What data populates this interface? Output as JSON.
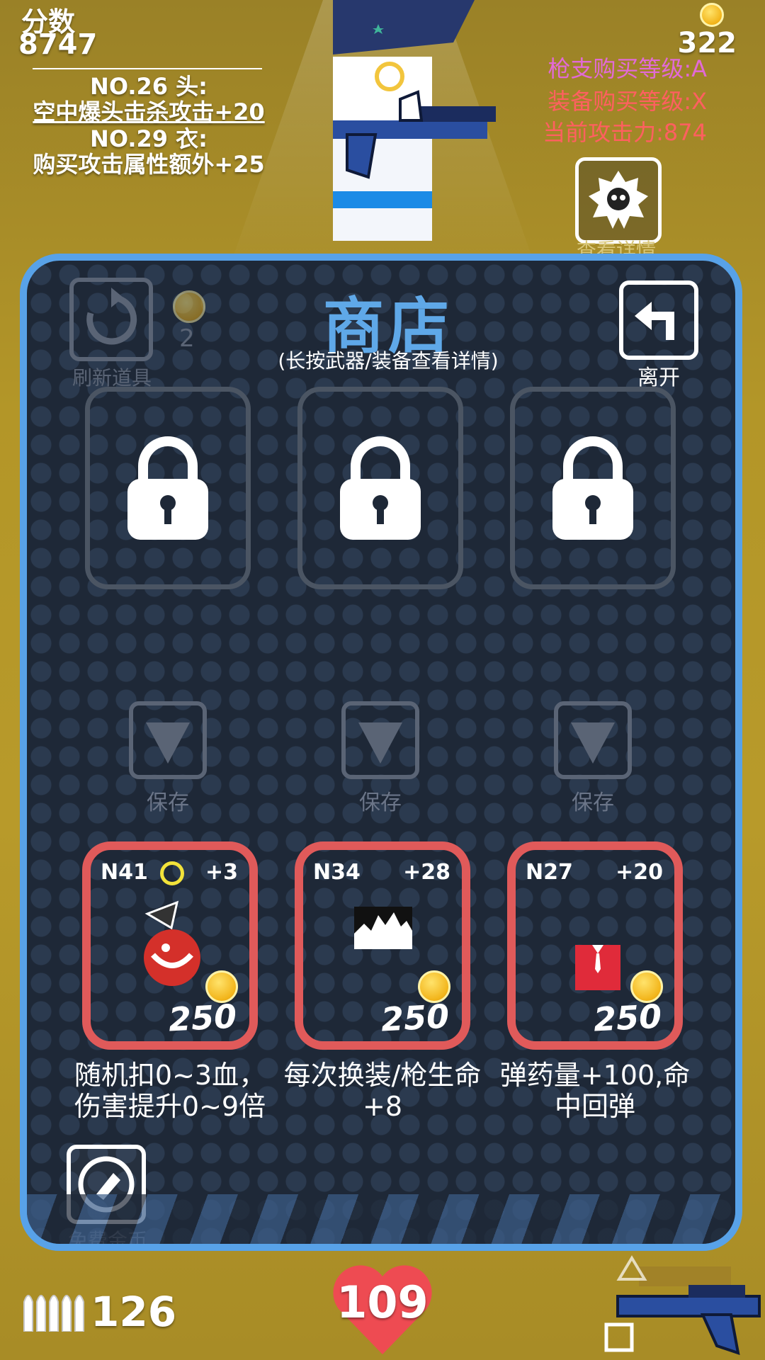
{
  "hud": {
    "score_label": "分数",
    "score_value": "8747",
    "buffs": [
      {
        "title": "NO.26 头:",
        "desc": "空中爆头击杀攻击+20"
      },
      {
        "title": "NO.29 衣:",
        "desc": "购买攻击属性额外+25"
      }
    ],
    "coins": "322",
    "gun_level": "枪支购买等级:A",
    "gear_level": "装备购买等级:X",
    "attack": "当前攻击力:874",
    "details_label": "查看详情",
    "ammo": "126",
    "hp": "109",
    "colors": {
      "gun_level": "#e26ad6",
      "gear_level": "#ff6060",
      "attack": "#ff6060"
    }
  },
  "shop": {
    "title": "商店",
    "subtitle": "(长按武器/装备查看详情)",
    "refresh_label": "刷新道具",
    "refresh_cost": "2",
    "leave_label": "离开",
    "save_labels": [
      "保存",
      "保存",
      "保存"
    ],
    "items": [
      {
        "code": "N41",
        "bonus": "+3",
        "price": "250",
        "desc": "随机扣0~3血，伤害提升0~9倍",
        "icon": "red-hook-creature-icon"
      },
      {
        "code": "N34",
        "bonus": "+28",
        "price": "250",
        "desc": "每次换装/枪生命+8",
        "icon": "mountain-icon"
      },
      {
        "code": "N27",
        "bonus": "+20",
        "price": "250",
        "desc": "弹药量+100,命中回弹",
        "icon": "red-shirt-icon"
      }
    ],
    "free_coins_label": "免费金币",
    "colors": {
      "panel_border": "#58a2e8",
      "card_border": "#e05a5a"
    }
  }
}
